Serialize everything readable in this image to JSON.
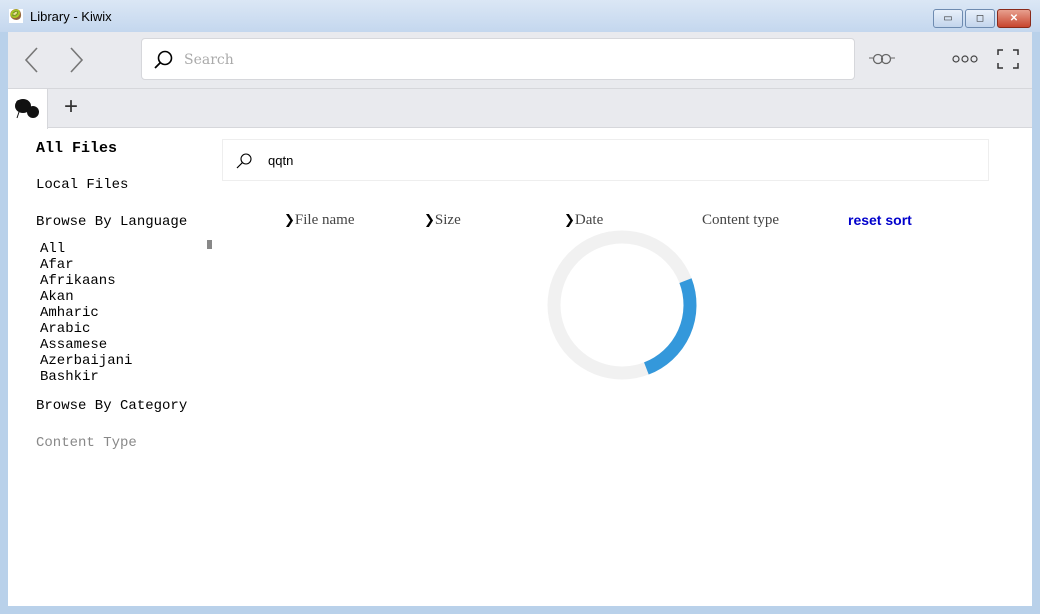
{
  "window": {
    "title": "Library - Kiwix",
    "minimize": "▭",
    "maximize": "◻",
    "close": "✕"
  },
  "toolbar": {
    "back_icon": "chevron-left",
    "forward_icon": "chevron-right",
    "search_placeholder": "Search",
    "reading_icon": "glasses",
    "menu_icon": "ellipsis",
    "fullscreen_icon": "fullscreen"
  },
  "tabs": {
    "new_tab": "+"
  },
  "sidebar": {
    "all_files": "All Files",
    "local_files": "Local Files",
    "browse_language": "Browse By Language",
    "languages": [
      "All",
      "Afar",
      "Afrikaans",
      "Akan",
      "Amharic",
      "Arabic",
      "Assamese",
      "Azerbaijani",
      "Bashkir"
    ],
    "browse_category": "Browse By Category",
    "content_type": "Content Type"
  },
  "main": {
    "filter_value": "qqtn",
    "columns": [
      "File name",
      "Size",
      "Date",
      "Content type"
    ],
    "reset_sort": "reset sort",
    "loading_progress_percent": 25,
    "accent": "#3498db"
  }
}
